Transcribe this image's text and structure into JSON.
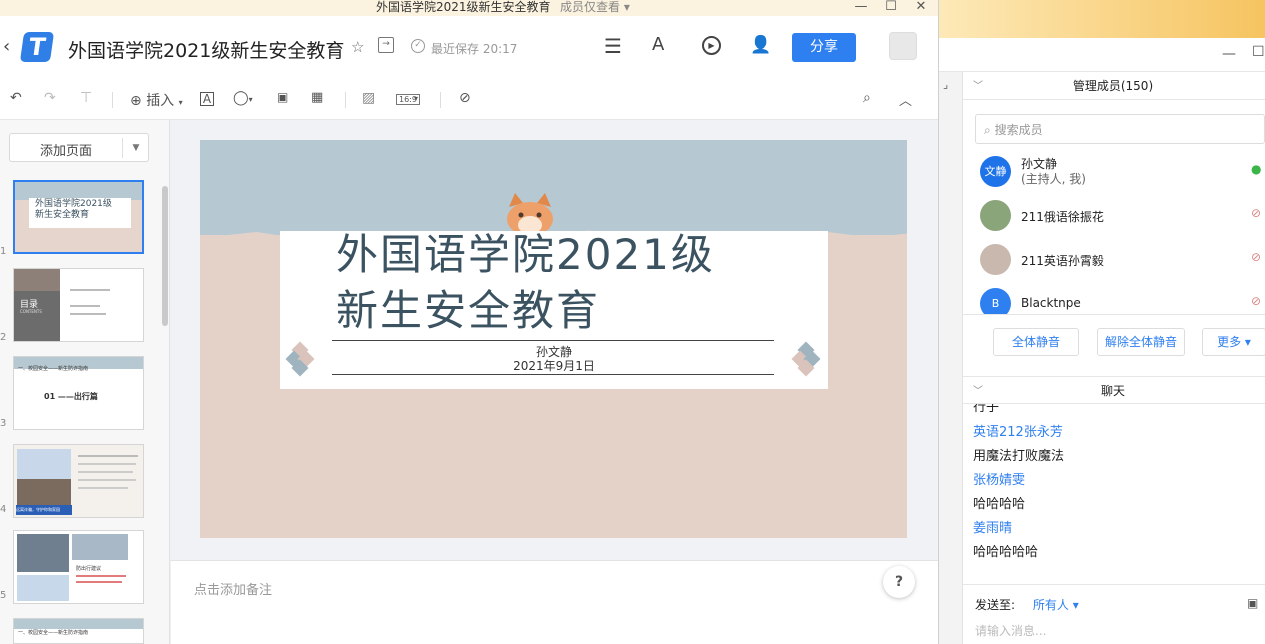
{
  "titlebar": {
    "title": "外国语学院2021级新生安全教育",
    "subtitle": "成员仅查看 ▾",
    "min": "—",
    "max": "☐",
    "close": "✕"
  },
  "header": {
    "back": "‹",
    "doc_title": "外国语学院2021级新生安全教育",
    "saved": "最近保存 20:17",
    "share": "分享"
  },
  "toolbar": {
    "insert": "插入",
    "size_badge": "16:9"
  },
  "leftpanel": {
    "add_page": "添加页面",
    "slides": [
      {
        "num": "1",
        "line1": "外国语学院2021级",
        "line2": "新生安全教育"
      },
      {
        "num": "2",
        "label": "目录",
        "sub": "CONTENTS"
      },
      {
        "num": "3",
        "text": "01 ——出行篇",
        "header": "一、校园安全——新生防诈指南"
      },
      {
        "num": "4",
        "caption": "远离诈骗，守护你和家园"
      },
      {
        "num": "5",
        "text": "防出行建议"
      },
      {
        "num": "6",
        "text": "一、校园安全——新生防诈指南"
      }
    ]
  },
  "slide": {
    "title_line1": "外国语学院2021级",
    "title_line2": "新生安全教育",
    "presenter": "孙文静",
    "date": "2021年9月1日"
  },
  "notes": {
    "placeholder": "点击添加备注",
    "help": "?"
  },
  "members": {
    "header": "管理成员(150)",
    "search_placeholder": "搜索成员",
    "list": [
      {
        "avatar": "文静",
        "name": "孙文静",
        "role": "(主持人, 我)"
      },
      {
        "avatar": "",
        "name": "211俄语徐振花"
      },
      {
        "avatar": "",
        "name": "211英语孙霄毅"
      },
      {
        "avatar": "B",
        "name": "Blacktnpe"
      }
    ],
    "mute_all": "全体静音",
    "unmute_all": "解除全体静音",
    "more": "更多 ▾"
  },
  "chat": {
    "header": "聊天",
    "messages": [
      {
        "type": "text",
        "text": "行子"
      },
      {
        "type": "name",
        "text": "英语212张永芳"
      },
      {
        "type": "text",
        "text": "用魔法打败魔法"
      },
      {
        "type": "name",
        "text": "张杨婧雯"
      },
      {
        "type": "text",
        "text": "哈哈哈哈"
      },
      {
        "type": "name",
        "text": "姜雨晴"
      },
      {
        "type": "text",
        "text": "哈哈哈哈哈"
      }
    ],
    "send_to_label": "发送至:",
    "send_to_value": "所有人 ▾",
    "input_placeholder": "请输入消息..."
  },
  "colors": {
    "accent": "#2e7ff0",
    "slide_title": "#3b5261",
    "slide_bg": "#e4d2c9",
    "sky": "#b6c9d2"
  }
}
